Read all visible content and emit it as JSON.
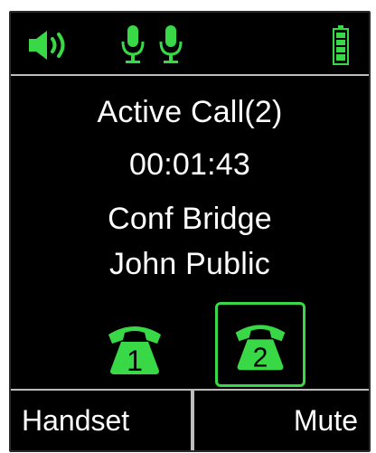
{
  "status_bar": {
    "speaker_icon": "speaker-volume-icon",
    "mic_icons": [
      "microphone-icon",
      "microphone-icon"
    ],
    "battery_icon": "battery-full-icon",
    "accent_color": "#39d846"
  },
  "call": {
    "state": "Active Call(2)",
    "duration": "00:01:43",
    "line1": "Conf Bridge",
    "line2": "John Public"
  },
  "lines": [
    {
      "number": "1",
      "icon": "phone-handset-icon",
      "selected": false
    },
    {
      "number": "2",
      "icon": "phone-handset-icon",
      "selected": true
    }
  ],
  "softkeys": {
    "left": "Handset",
    "right": "Mute"
  }
}
